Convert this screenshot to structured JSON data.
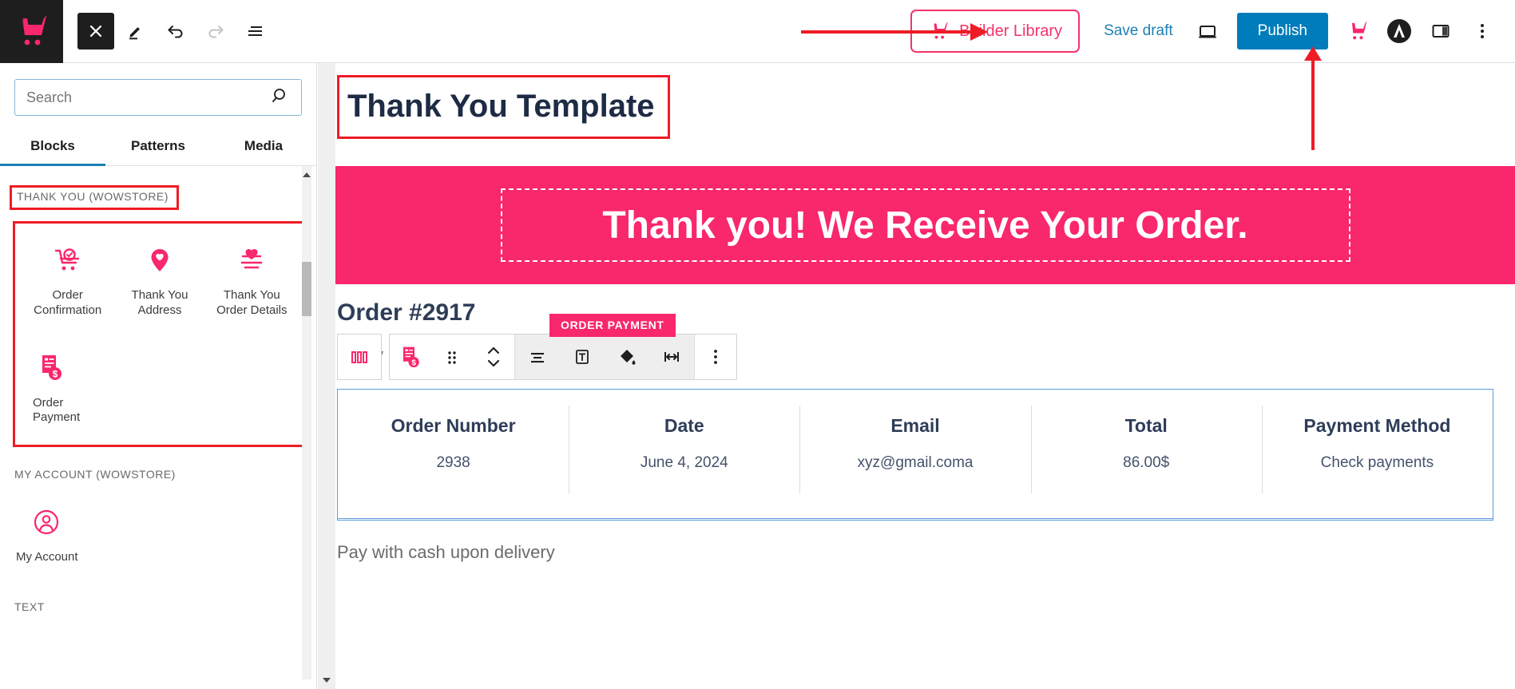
{
  "topbar": {
    "logo_icon": "wowstore-cart-logo",
    "close_label": "Close",
    "edit_label": "Edit",
    "undo_label": "Undo",
    "redo_label": "Redo",
    "list_view_label": "List View",
    "builder_library_label": "Builder Library",
    "save_draft_label": "Save draft",
    "preview_label": "Preview",
    "publish_label": "Publish",
    "wowstore_label": "WowStore",
    "astra_label": "Astra",
    "settings_label": "Settings",
    "options_label": "Options"
  },
  "sidebar": {
    "search": {
      "value": "",
      "placeholder": "Search"
    },
    "tabs": [
      {
        "label": "Blocks",
        "active": true
      },
      {
        "label": "Patterns",
        "active": false
      },
      {
        "label": "Media",
        "active": false
      }
    ],
    "categories": [
      {
        "label": "THANK YOU (WOWSTORE)",
        "highlighted": true,
        "blocks": [
          {
            "label": "Order\nConfirmation",
            "icon": "cart-check-icon"
          },
          {
            "label": "Thank You\nAddress",
            "icon": "map-pin-heart-icon"
          },
          {
            "label": "Thank You\nOrder Details",
            "icon": "heart-lines-icon"
          },
          {
            "label": "Order Payment",
            "icon": "invoice-dollar-icon"
          }
        ]
      },
      {
        "label": "MY ACCOUNT (WOWSTORE)",
        "highlighted": false,
        "blocks": [
          {
            "label": "My Account",
            "icon": "user-circle-icon"
          }
        ]
      },
      {
        "label": "TEXT",
        "highlighted": false,
        "blocks": []
      }
    ]
  },
  "canvas": {
    "page_title": "Thank You Template",
    "hero_text": "Thank you! We Receive Your Order.",
    "order_heading": "Order #2917",
    "ghost_text": "y",
    "block_toolbar": {
      "badge_label": "ORDER PAYMENT",
      "parent_block_icon": "columns-icon",
      "block_type_icon": "order-payment-icon",
      "drag_label": "Drag",
      "move_label": "Move up or down",
      "align_label": "Align",
      "text_label": "Text",
      "color_label": "Color",
      "width_label": "Width",
      "more_label": "Options"
    },
    "order_table": {
      "columns": [
        {
          "header": "Order Number",
          "value": "2938"
        },
        {
          "header": "Date",
          "value": "June 4, 2024"
        },
        {
          "header": "Email",
          "value": "xyz@gmail.coma"
        },
        {
          "header": "Total",
          "value": "86.00$"
        },
        {
          "header": "Payment Method",
          "value": "Check payments"
        }
      ]
    },
    "payment_note": "Pay with cash upon delivery"
  },
  "colors": {
    "brand_pink": "#f9276b",
    "publish_blue": "#007cba",
    "link_blue": "#1d7fb3",
    "annotation_red": "#ee1c25",
    "title_navy": "#1e2b45"
  }
}
